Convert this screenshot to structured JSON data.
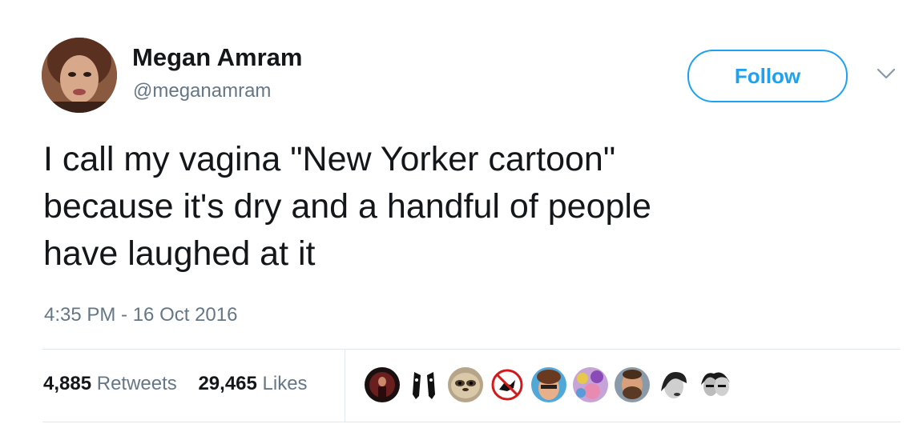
{
  "author": {
    "display_name": "Megan Amram",
    "handle": "@meganamram",
    "avatar_icon": "user-avatar-photo"
  },
  "follow_label": "Follow",
  "tweet_text": "I call my vagina \"New Yorker cartoon\"\nbecause it's dry and a handful of people\nhave laughed at it",
  "timestamp": "4:35 PM - 16 Oct 2016",
  "stats": {
    "retweets_count": "4,885",
    "retweets_label": "Retweets",
    "likes_count": "29,465",
    "likes_label": "Likes"
  },
  "colors": {
    "accent": "#1da1f2",
    "text": "#14171a",
    "secondary": "#657786",
    "divider": "#e1e8ed"
  },
  "likers": [
    {
      "icon": "liker-avatar-1"
    },
    {
      "icon": "liker-avatar-2"
    },
    {
      "icon": "liker-avatar-3"
    },
    {
      "icon": "liker-avatar-4"
    },
    {
      "icon": "liker-avatar-5"
    },
    {
      "icon": "liker-avatar-6"
    },
    {
      "icon": "liker-avatar-7"
    },
    {
      "icon": "liker-avatar-8"
    },
    {
      "icon": "liker-avatar-9"
    }
  ]
}
